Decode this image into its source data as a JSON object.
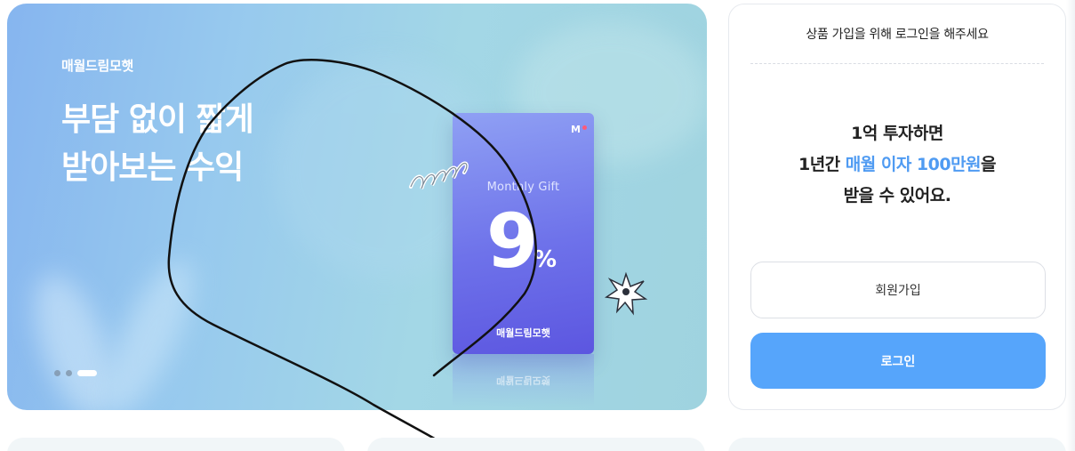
{
  "hero": {
    "brand": "매월드림모햇",
    "headline_line1": "부담 없이 짧게",
    "headline_line2": "받아보는 수익",
    "slides": {
      "total": 3,
      "active": 3
    },
    "card": {
      "subtitle": "Monthly Gift",
      "rate": "9",
      "percent": "%",
      "brand": "매월드림모햇",
      "logo": "M"
    }
  },
  "login_panel": {
    "prompt": "상품 가입을 위해 로그인을 해주세요",
    "promo_line1": "1억 투자하면",
    "promo_line2_pre": "1년간 ",
    "promo_line2_highlight": "매월 이자 100만원",
    "promo_line2_post": "을",
    "promo_line3": "받을 수 있어요.",
    "signup_label": "회원가입",
    "login_label": "로그인"
  },
  "colors": {
    "accent": "#56a5fb",
    "highlight": "#4f9bf2",
    "card": "#6e72ea"
  }
}
